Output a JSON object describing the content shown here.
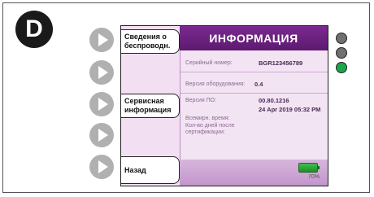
{
  "badge": "D",
  "title": "ИНФОРМАЦИЯ",
  "sidebar": {
    "btn1": "Сведения о беспроводн.",
    "btn2": "Сервисная информация",
    "back": "Назад"
  },
  "info": {
    "serial_label": "Серийный номер:",
    "serial_value": "BGR123456789",
    "hw_label": "Версия оборудования:",
    "hw_value": "0.4",
    "sw_label": "Версия ПО:",
    "sw_value": "00.80.1216",
    "time_label": "Всемирн. время:",
    "time_value": "24 Apr 2019 05:32 PM",
    "days_label": "Кол-во дней после сертификации:"
  },
  "battery": {
    "percent": "70%",
    "level": 0.7
  },
  "leds": [
    "#707070",
    "#707070",
    "#1aa64a"
  ]
}
